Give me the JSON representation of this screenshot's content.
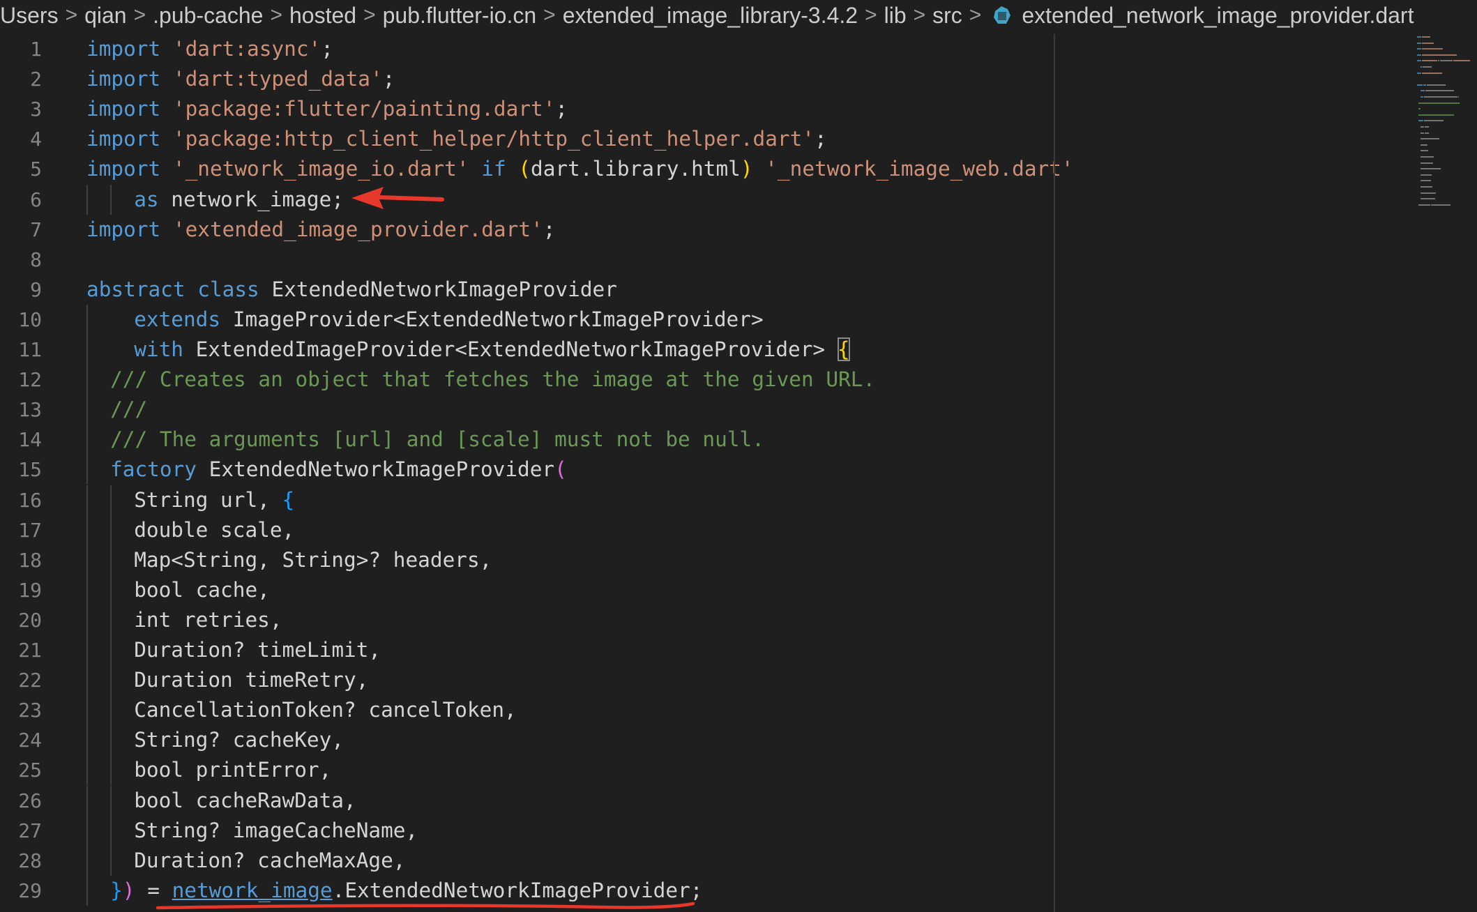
{
  "breadcrumb": {
    "items": [
      "Users",
      "qian",
      ".pub-cache",
      "hosted",
      "pub.flutter-io.cn",
      "extended_image_library-3.4.2",
      "lib",
      "src"
    ],
    "file": "extended_network_image_provider.dart",
    "icon": "dart-file-icon",
    "separator": ">"
  },
  "editor": {
    "language": "dart",
    "lines": [
      {
        "n": "1",
        "indent": 0,
        "tokens": [
          [
            "kw",
            "import"
          ],
          [
            "pl",
            " "
          ],
          [
            "str",
            "'dart:async'"
          ],
          [
            "pl",
            ";"
          ]
        ]
      },
      {
        "n": "2",
        "indent": 0,
        "tokens": [
          [
            "kw",
            "import"
          ],
          [
            "pl",
            " "
          ],
          [
            "str",
            "'dart:typed_data'"
          ],
          [
            "pl",
            ";"
          ]
        ]
      },
      {
        "n": "3",
        "indent": 0,
        "tokens": [
          [
            "kw",
            "import"
          ],
          [
            "pl",
            " "
          ],
          [
            "str",
            "'package:flutter/painting.dart'"
          ],
          [
            "pl",
            ";"
          ]
        ]
      },
      {
        "n": "4",
        "indent": 0,
        "tokens": [
          [
            "kw",
            "import"
          ],
          [
            "pl",
            " "
          ],
          [
            "str",
            "'package:http_client_helper/http_client_helper.dart'"
          ],
          [
            "pl",
            ";"
          ]
        ]
      },
      {
        "n": "5",
        "indent": 0,
        "tokens": [
          [
            "kw",
            "import"
          ],
          [
            "pl",
            " "
          ],
          [
            "str",
            "'_network_image_io.dart'"
          ],
          [
            "pl",
            " "
          ],
          [
            "kw",
            "if"
          ],
          [
            "pl",
            " "
          ],
          [
            "br1",
            "("
          ],
          [
            "id",
            "dart.library.html"
          ],
          [
            "br1",
            ")"
          ],
          [
            "pl",
            " "
          ],
          [
            "str",
            "'_network_image_web.dart'"
          ]
        ]
      },
      {
        "n": "6",
        "indent": 4,
        "tokens": [
          [
            "kw",
            "as"
          ],
          [
            "pl",
            " "
          ],
          [
            "id",
            "network_image"
          ],
          [
            "pl",
            ";"
          ]
        ]
      },
      {
        "n": "7",
        "indent": 0,
        "tokens": [
          [
            "kw",
            "import"
          ],
          [
            "pl",
            " "
          ],
          [
            "str",
            "'extended_image_provider.dart'"
          ],
          [
            "pl",
            ";"
          ]
        ]
      },
      {
        "n": "8",
        "indent": 0,
        "tokens": []
      },
      {
        "n": "9",
        "indent": 0,
        "tokens": [
          [
            "kw",
            "abstract"
          ],
          [
            "pl",
            " "
          ],
          [
            "kw",
            "class"
          ],
          [
            "pl",
            " "
          ],
          [
            "ty",
            "ExtendedNetworkImageProvider"
          ]
        ]
      },
      {
        "n": "10",
        "indent": 4,
        "tokens": [
          [
            "kw",
            "extends"
          ],
          [
            "pl",
            " "
          ],
          [
            "ty",
            "ImageProvider<ExtendedNetworkImageProvider>"
          ]
        ]
      },
      {
        "n": "11",
        "indent": 4,
        "tokens": [
          [
            "kw",
            "with"
          ],
          [
            "pl",
            " "
          ],
          [
            "ty",
            "ExtendedImageProvider<ExtendedNetworkImageProvider>"
          ],
          [
            "pl",
            " "
          ],
          [
            "hlbr",
            "{"
          ]
        ]
      },
      {
        "n": "12",
        "indent": 2,
        "tokens": [
          [
            "cm",
            "/// Creates an object that fetches the image at the given URL."
          ]
        ]
      },
      {
        "n": "13",
        "indent": 2,
        "tokens": [
          [
            "cm",
            "///"
          ]
        ]
      },
      {
        "n": "14",
        "indent": 2,
        "tokens": [
          [
            "cm",
            "/// The arguments [url] and [scale] must not be null."
          ]
        ]
      },
      {
        "n": "15",
        "indent": 2,
        "tokens": [
          [
            "kw",
            "factory"
          ],
          [
            "pl",
            " "
          ],
          [
            "ty",
            "ExtendedNetworkImageProvider"
          ],
          [
            "br2",
            "("
          ]
        ]
      },
      {
        "n": "16",
        "indent": 4,
        "tokens": [
          [
            "ty",
            "String"
          ],
          [
            "pl",
            " url, "
          ],
          [
            "br3",
            "{"
          ]
        ]
      },
      {
        "n": "17",
        "indent": 4,
        "tokens": [
          [
            "ty",
            "double"
          ],
          [
            "pl",
            " scale,"
          ]
        ]
      },
      {
        "n": "18",
        "indent": 4,
        "tokens": [
          [
            "ty",
            "Map<String, String>?"
          ],
          [
            "pl",
            " headers,"
          ]
        ]
      },
      {
        "n": "19",
        "indent": 4,
        "tokens": [
          [
            "ty",
            "bool"
          ],
          [
            "pl",
            " cache,"
          ]
        ]
      },
      {
        "n": "20",
        "indent": 4,
        "tokens": [
          [
            "ty",
            "int"
          ],
          [
            "pl",
            " retries,"
          ]
        ]
      },
      {
        "n": "21",
        "indent": 4,
        "tokens": [
          [
            "ty",
            "Duration?"
          ],
          [
            "pl",
            " timeLimit,"
          ]
        ]
      },
      {
        "n": "22",
        "indent": 4,
        "tokens": [
          [
            "ty",
            "Duration"
          ],
          [
            "pl",
            " timeRetry,"
          ]
        ]
      },
      {
        "n": "23",
        "indent": 4,
        "tokens": [
          [
            "ty",
            "CancellationToken?"
          ],
          [
            "pl",
            " cancelToken,"
          ]
        ]
      },
      {
        "n": "24",
        "indent": 4,
        "tokens": [
          [
            "ty",
            "String?"
          ],
          [
            "pl",
            " cacheKey,"
          ]
        ]
      },
      {
        "n": "25",
        "indent": 4,
        "tokens": [
          [
            "ty",
            "bool"
          ],
          [
            "pl",
            " printError,"
          ]
        ]
      },
      {
        "n": "26",
        "indent": 4,
        "tokens": [
          [
            "ty",
            "bool"
          ],
          [
            "pl",
            " cacheRawData,"
          ]
        ]
      },
      {
        "n": "27",
        "indent": 4,
        "tokens": [
          [
            "ty",
            "String?"
          ],
          [
            "pl",
            " imageCacheName,"
          ]
        ]
      },
      {
        "n": "28",
        "indent": 4,
        "tokens": [
          [
            "ty",
            "Duration?"
          ],
          [
            "pl",
            " cacheMaxAge,"
          ]
        ]
      },
      {
        "n": "29",
        "indent": 2,
        "tokens": [
          [
            "br3",
            "}"
          ],
          [
            "br2",
            ")"
          ],
          [
            "pl",
            " = "
          ],
          [
            "link",
            "network_image"
          ],
          [
            "pl",
            ".ExtendedNetworkImageProvider;"
          ]
        ]
      }
    ]
  },
  "colors": {
    "background": "#1f1f1f",
    "keyword": "#569cd6",
    "string": "#ce9178",
    "comment": "#6a9955",
    "line_number": "#858585",
    "annotation_red": "#e8382b"
  },
  "annotations": {
    "arrow_target_line": "6",
    "underline_line": "29"
  }
}
